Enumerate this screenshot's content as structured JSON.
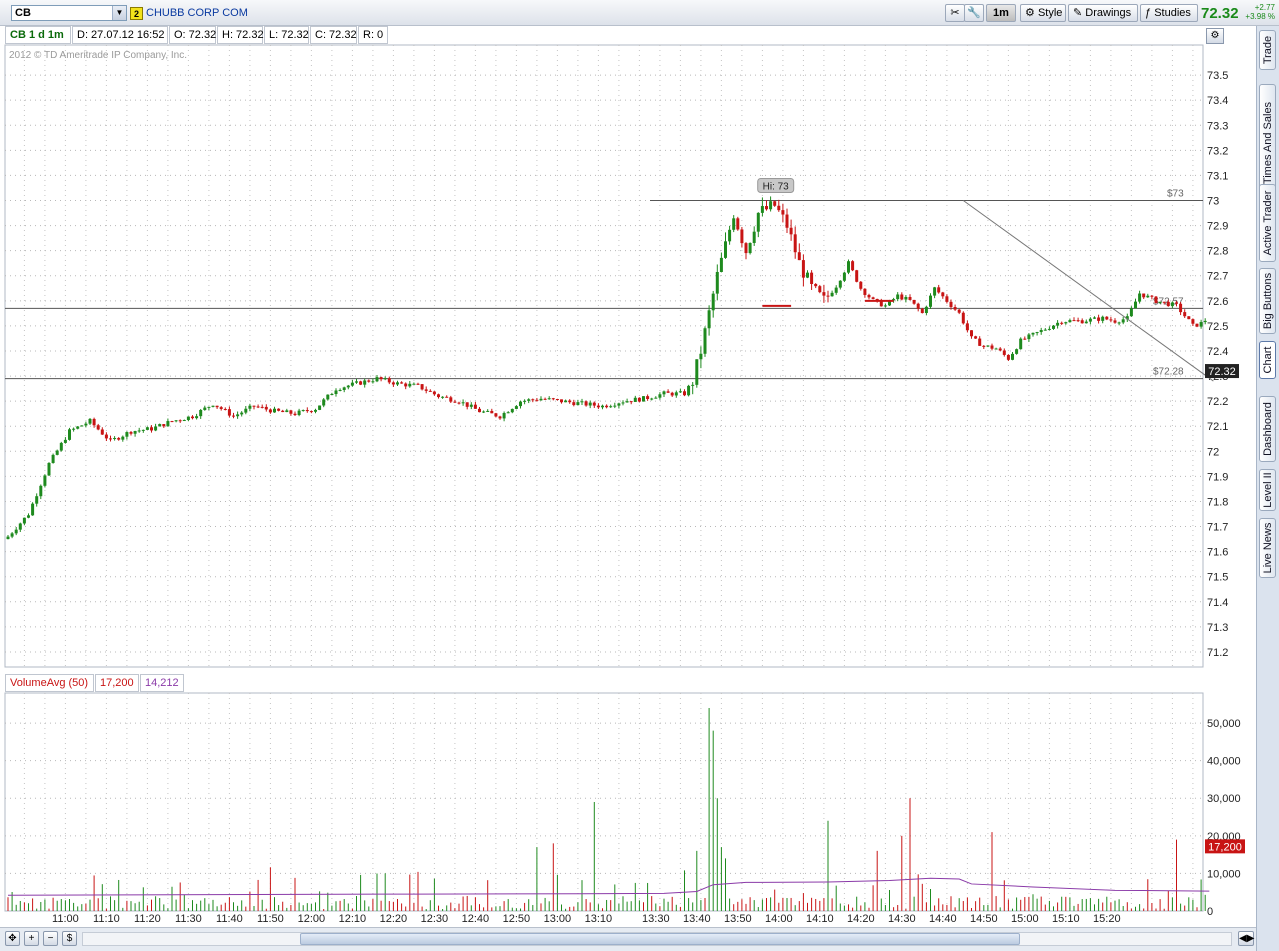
{
  "toolbar": {
    "symbol": "CB",
    "link_number": "2",
    "company_name": "CHUBB CORP COM",
    "timeframe": "1m",
    "style_label": "Style",
    "drawings_label": "Drawings",
    "studies_label": "Studies",
    "last_price": "72.32",
    "net_change": "+2.77",
    "pct_change": "+3.98 %"
  },
  "infobar": {
    "title": "CB 1 d 1m",
    "date": "D: 27.07.12 16:52",
    "open": "O: 72.32",
    "high": "H: 72.32",
    "low": "L: 72.32",
    "close": "C: 72.32",
    "range": "R: 0"
  },
  "copyright": "2012 © TD Ameritrade IP Company, Inc.",
  "volume_header": {
    "label": "VolumeAvg (50)",
    "volume": "17,200",
    "average": "14,212"
  },
  "sidebar": {
    "tabs": [
      "Trade",
      "Times And Sales",
      "Active Trader",
      "Big Buttons",
      "Chart",
      "Dashboard",
      "Level II",
      "Live News"
    ],
    "active": "Chart"
  },
  "colors": {
    "up": "#1e8a1e",
    "down": "#c81414",
    "volume_avg": "#8a3aa8",
    "background": "#ffffff",
    "last_price_tag": "#222222",
    "volume_tag": "#c81414"
  },
  "chart_data": [
    {
      "type": "candlestick",
      "title": "",
      "y_ticks": [
        "73.5",
        "73.4",
        "73.3",
        "73.2",
        "73.1",
        "73",
        "72.9",
        "72.8",
        "72.7",
        "72.6",
        "72.5",
        "72.4",
        "72.3",
        "72.2",
        "72.1",
        "72",
        "71.9",
        "71.8",
        "71.7",
        "71.6",
        "71.5",
        "71.4",
        "71.3",
        "71.2"
      ],
      "ylim": [
        71.14,
        73.62
      ],
      "x_ticks": [
        "11:00",
        "11:10",
        "11:20",
        "11:30",
        "11:40",
        "11:50",
        "12:00",
        "12:10",
        "12:20",
        "12:30",
        "12:40",
        "12:50",
        "13:00",
        "13:10",
        "13:30",
        "13:40",
        "13:50",
        "14:00",
        "14:10",
        "14:20",
        "14:30",
        "14:40",
        "14:50",
        "15:00",
        "15:10",
        "15:20"
      ],
      "grid": true,
      "annotations": {
        "high_label": "Hi: 73",
        "level_high_label": "$73",
        "level_mid_label": "$72.57",
        "level_low_label": "$72.28",
        "last_price_tag": "72.32"
      },
      "levels": [
        73.0,
        72.57,
        72.29
      ],
      "trendline": [
        {
          "t": 233,
          "p": 73.0
        },
        {
          "t": 294,
          "p": 72.28
        }
      ],
      "anchors": [
        [
          0,
          71.66
        ],
        [
          5,
          71.75
        ],
        [
          10,
          71.95
        ],
        [
          15,
          72.08
        ],
        [
          20,
          72.12
        ],
        [
          25,
          72.04
        ],
        [
          30,
          72.08
        ],
        [
          35,
          72.09
        ],
        [
          40,
          72.12
        ],
        [
          45,
          72.14
        ],
        [
          50,
          72.19
        ],
        [
          55,
          72.14
        ],
        [
          60,
          72.18
        ],
        [
          65,
          72.16
        ],
        [
          70,
          72.15
        ],
        [
          75,
          72.17
        ],
        [
          80,
          72.25
        ],
        [
          85,
          72.27
        ],
        [
          90,
          72.29
        ],
        [
          95,
          72.27
        ],
        [
          100,
          72.26
        ],
        [
          105,
          72.22
        ],
        [
          110,
          72.2
        ],
        [
          115,
          72.16
        ],
        [
          120,
          72.14
        ],
        [
          125,
          72.2
        ],
        [
          130,
          72.21
        ],
        [
          135,
          72.2
        ],
        [
          140,
          72.19
        ],
        [
          145,
          72.18
        ],
        [
          150,
          72.2
        ],
        [
          155,
          72.21
        ],
        [
          160,
          72.23
        ],
        [
          165,
          72.23
        ],
        [
          167,
          72.28
        ],
        [
          169,
          72.4
        ],
        [
          171,
          72.55
        ],
        [
          173,
          72.7
        ],
        [
          175,
          72.82
        ],
        [
          177,
          72.95
        ],
        [
          180,
          72.8
        ],
        [
          183,
          72.95
        ],
        [
          187,
          72.98
        ],
        [
          190,
          72.9
        ],
        [
          193,
          72.75
        ],
        [
          196,
          72.65
        ],
        [
          199,
          72.6
        ],
        [
          202,
          72.66
        ],
        [
          205,
          72.75
        ],
        [
          208,
          72.65
        ],
        [
          211,
          72.6
        ],
        [
          214,
          72.58
        ],
        [
          217,
          72.62
        ],
        [
          220,
          72.6
        ],
        [
          223,
          72.55
        ],
        [
          226,
          72.65
        ],
        [
          229,
          72.6
        ],
        [
          232,
          72.55
        ],
        [
          235,
          72.45
        ],
        [
          238,
          72.42
        ],
        [
          241,
          72.41
        ],
        [
          244,
          72.37
        ],
        [
          247,
          72.44
        ],
        [
          252,
          72.48
        ],
        [
          257,
          72.52
        ],
        [
          262,
          72.52
        ],
        [
          267,
          72.53
        ],
        [
          270,
          72.52
        ],
        [
          273,
          72.53
        ],
        [
          276,
          72.63
        ],
        [
          280,
          72.6
        ],
        [
          285,
          72.58
        ],
        [
          289,
          72.5
        ],
        [
          293,
          72.52
        ]
      ]
    },
    {
      "type": "bar",
      "title": "VolumeAvg (50)",
      "y_ticks": [
        "50,000",
        "40,000",
        "30,000",
        "20,000",
        "10,000",
        "0"
      ],
      "ylim": [
        0,
        58000
      ],
      "latest_volume": 17200,
      "latest_average": 14212,
      "spikes": [
        {
          "t": 171,
          "v": 54000
        },
        {
          "t": 172,
          "v": 48000
        },
        {
          "t": 173,
          "v": 30000
        },
        {
          "t": 174,
          "v": 17000
        },
        {
          "t": 168,
          "v": 16000
        },
        {
          "t": 200,
          "v": 24000
        },
        {
          "t": 220,
          "v": 30000
        },
        {
          "t": 218,
          "v": 20000
        },
        {
          "t": 212,
          "v": 16000
        },
        {
          "t": 240,
          "v": 21000
        },
        {
          "t": 143,
          "v": 29000
        },
        {
          "t": 129,
          "v": 17000
        },
        {
          "t": 133,
          "v": 18000
        },
        {
          "t": 285,
          "v": 19000
        },
        {
          "t": 175,
          "v": 14000
        }
      ],
      "avg_line": [
        [
          0,
          4200
        ],
        [
          30,
          4300
        ],
        [
          60,
          4400
        ],
        [
          100,
          4500
        ],
        [
          140,
          4600
        ],
        [
          160,
          4700
        ],
        [
          168,
          5200
        ],
        [
          172,
          7000
        ],
        [
          180,
          7600
        ],
        [
          200,
          7700
        ],
        [
          215,
          8100
        ],
        [
          225,
          8700
        ],
        [
          232,
          8500
        ],
        [
          235,
          7200
        ],
        [
          250,
          6400
        ],
        [
          270,
          5500
        ],
        [
          293,
          5300
        ]
      ]
    }
  ]
}
